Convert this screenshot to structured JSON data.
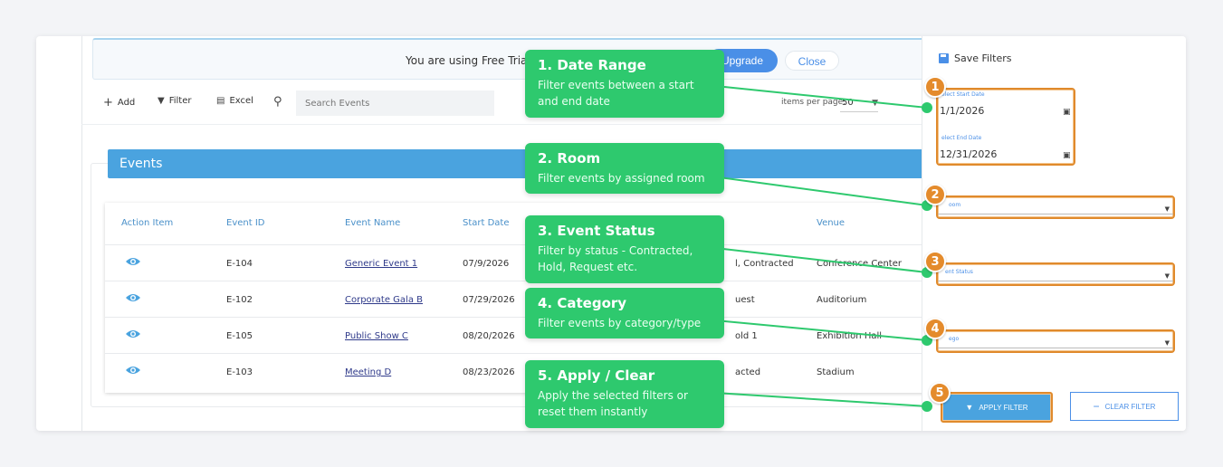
{
  "banner": {
    "text": "You are using Free Trial. Y",
    "upgrade": "Upgrade",
    "close": "Close"
  },
  "toolbar": {
    "add": "Add",
    "filter": "Filter",
    "excel": "Excel",
    "search_placeholder": "Search Events",
    "items_per_page_label": "items per page:",
    "items_per_page_value": "50"
  },
  "events": {
    "title": "Events",
    "columns": [
      "Action Item",
      "Event ID",
      "Event Name",
      "Start Date",
      "Venue"
    ],
    "rows": [
      {
        "id": "E-104",
        "name": "Generic Event 1",
        "start": "07/9/2026",
        "status": "l, Contracted",
        "venue": "Conference Center"
      },
      {
        "id": "E-102",
        "name": "Corporate Gala B",
        "start": "07/29/2026",
        "status": "uest",
        "venue": "Auditorium"
      },
      {
        "id": "E-105",
        "name": "Public Show C",
        "start": "08/20/2026",
        "status": "old 1",
        "venue": "Exhibition Hall"
      },
      {
        "id": "E-103",
        "name": "Meeting D",
        "start": "08/23/2026",
        "status": "acted",
        "venue": "Stadium"
      }
    ]
  },
  "panel": {
    "save_filters": "Save Filters",
    "start_label": "elect Start Date",
    "start_value": "1/1/2026",
    "end_label": "elect End Date",
    "end_value": "12/31/2026",
    "room_label": "oom",
    "status_label": "ent Status",
    "category_label": "ego",
    "apply": "APPLY FILTER",
    "clear": "CLEAR FILTER"
  },
  "callouts": [
    {
      "num": "1",
      "title": "1. Date Range",
      "desc": "Filter events between a start and end date"
    },
    {
      "num": "2",
      "title": "2. Room",
      "desc": "Filter events by assigned room"
    },
    {
      "num": "3",
      "title": "3. Event Status",
      "desc": "Filter by status - Contracted, Hold, Request etc."
    },
    {
      "num": "4",
      "title": "4. Category",
      "desc": "Filter events by category/type"
    },
    {
      "num": "5",
      "title": "5. Apply / Clear",
      "desc": "Apply the selected filters or reset them instantly"
    }
  ],
  "colors": {
    "callout": "#2ec96e",
    "highlight": "#e08a2c",
    "accent": "#4aa3df"
  }
}
